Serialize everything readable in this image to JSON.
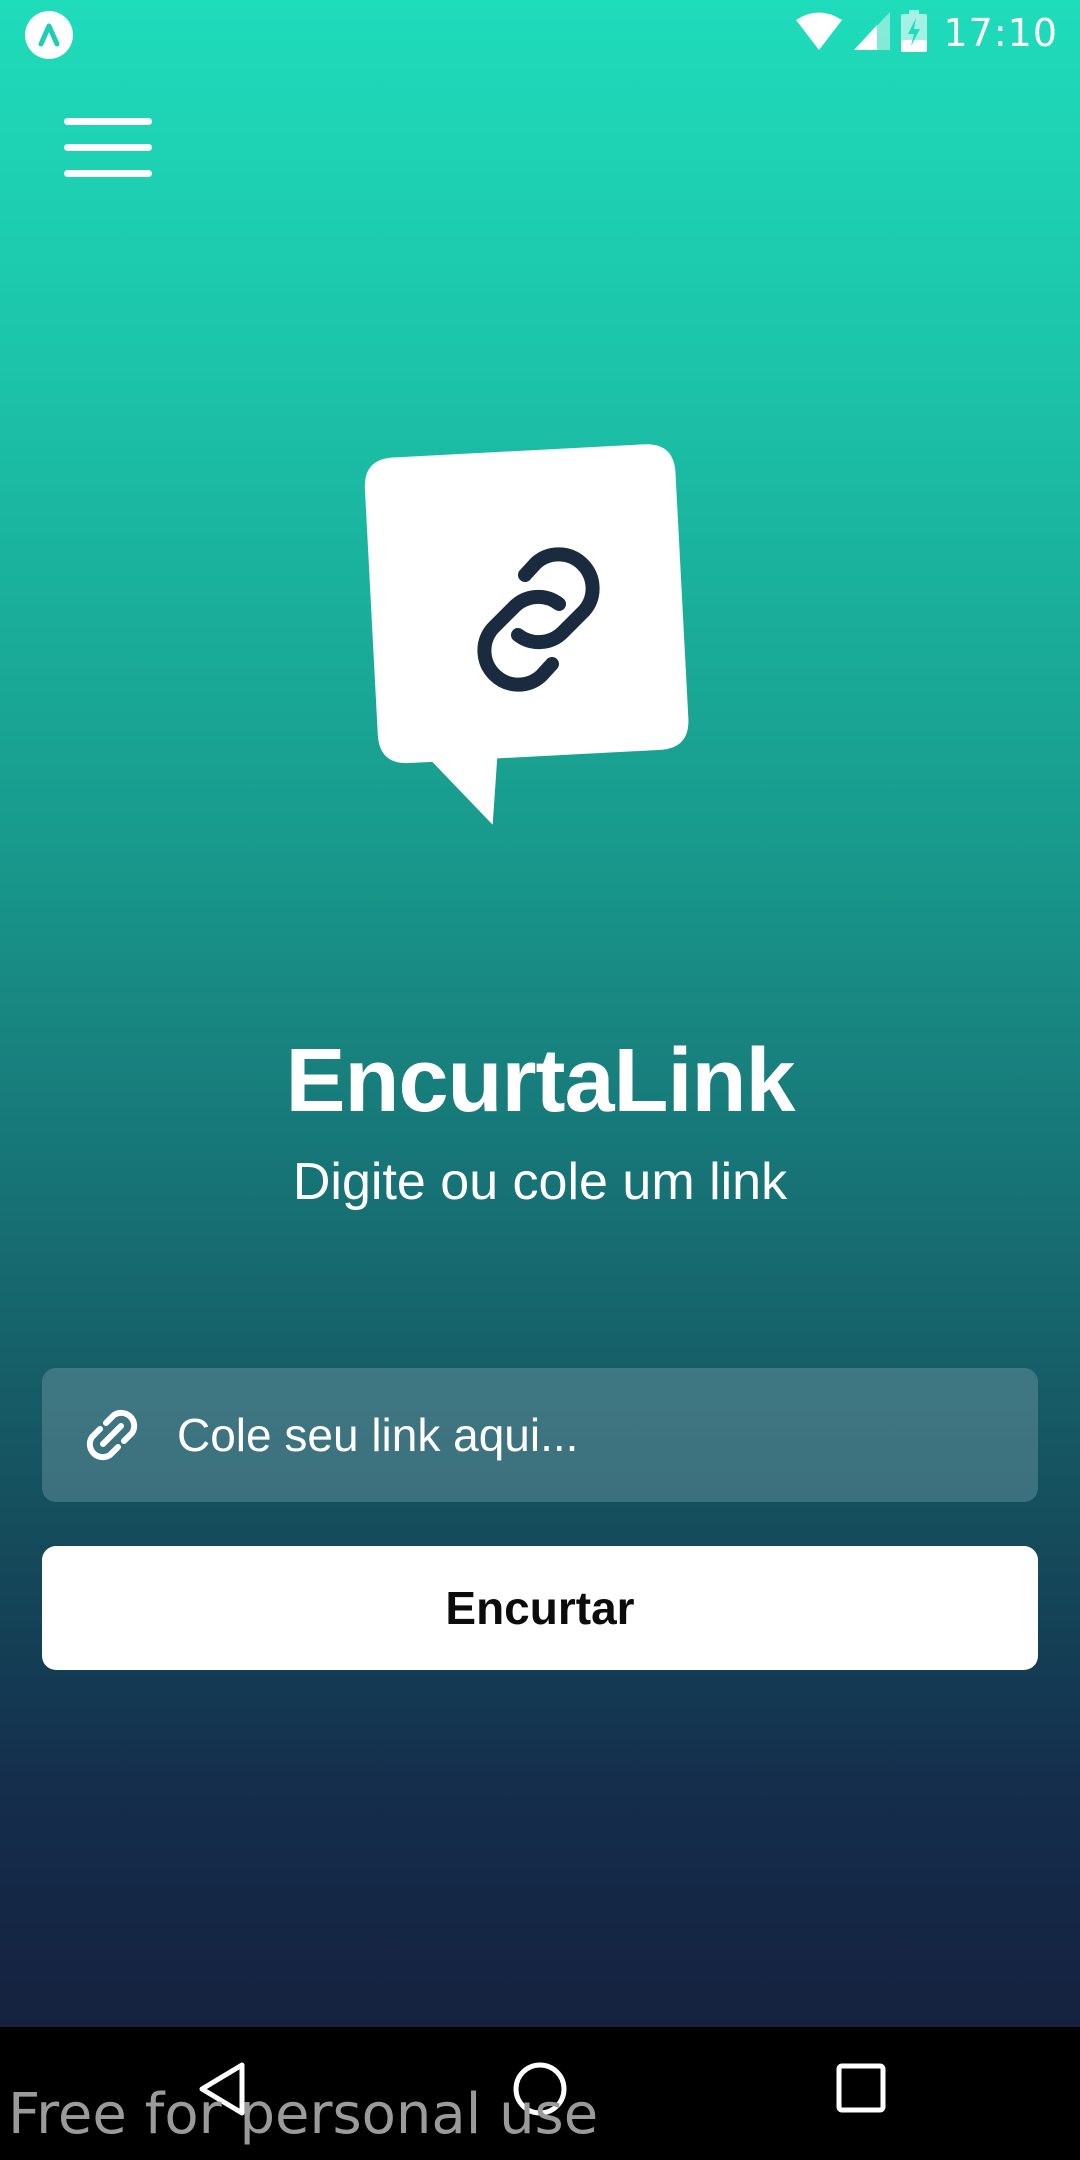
{
  "status_bar": {
    "time": "17:10",
    "icons": [
      "app-notification-icon",
      "wifi-icon",
      "cell-signal-icon",
      "battery-charging-icon"
    ]
  },
  "header": {
    "menu_icon": "hamburger-menu-icon"
  },
  "logo": {
    "icon": "link-chat-bubble-icon"
  },
  "main": {
    "title": "EncurtaLink",
    "subtitle": "Digite ou cole um link",
    "input": {
      "icon": "link-icon",
      "value": "",
      "placeholder": "Cole seu link aqui..."
    },
    "shorten_label": "Encurtar"
  },
  "nav_bar": {
    "icons": [
      "back-icon",
      "home-icon",
      "recents-icon"
    ]
  },
  "watermark": "Free for personal use",
  "colors": {
    "gradient_top": "#1fdcbb",
    "gradient_mid": "#18998c",
    "gradient_bottom": "#15213f",
    "logo_stroke": "#1a2b40",
    "button_bg": "#ffffff",
    "text": "#ffffff"
  }
}
